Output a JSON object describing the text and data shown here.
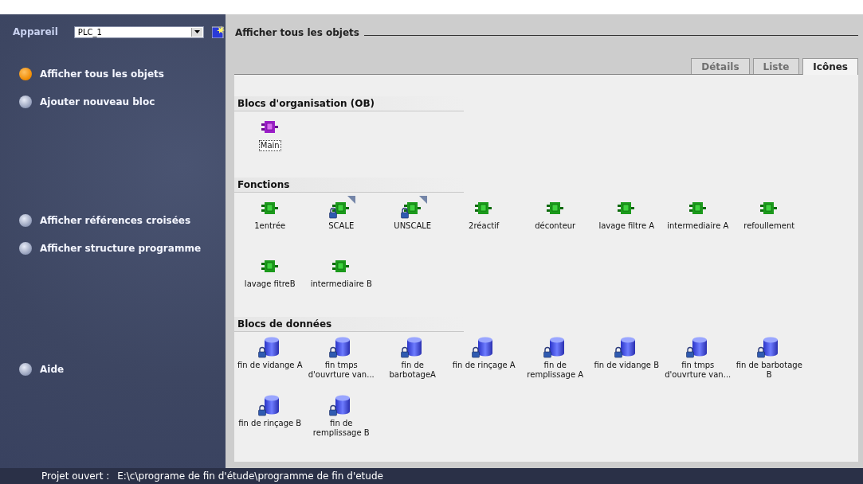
{
  "device": {
    "label": "Appareil",
    "value": "PLC_1"
  },
  "sidebar": {
    "items": [
      {
        "label": "Afficher tous les objets",
        "selected": true
      },
      {
        "label": "Ajouter nouveau bloc",
        "selected": false
      },
      {
        "label": "Afficher références croisées",
        "selected": false
      },
      {
        "label": "Afficher structure programme",
        "selected": false
      },
      {
        "label": "Aide",
        "selected": false
      }
    ]
  },
  "header": {
    "title": "Afficher tous les objets"
  },
  "tabs": [
    {
      "label": "Détails",
      "selected": false
    },
    {
      "label": "Liste",
      "selected": false
    },
    {
      "label": "Icônes",
      "selected": true
    }
  ],
  "groups": [
    {
      "title": "Blocs d'organisation (OB)",
      "blocks": [
        {
          "kind": "ob",
          "label": "Main",
          "protected": false,
          "library": false,
          "selected": true
        }
      ]
    },
    {
      "title": "Fonctions",
      "blocks": [
        {
          "kind": "fc",
          "label": "1entrée",
          "protected": false,
          "library": false,
          "selected": false
        },
        {
          "kind": "fc",
          "label": "SCALE",
          "protected": true,
          "library": true,
          "selected": false
        },
        {
          "kind": "fc",
          "label": "UNSCALE",
          "protected": true,
          "library": true,
          "selected": false
        },
        {
          "kind": "fc",
          "label": "2réactif",
          "protected": false,
          "library": false,
          "selected": false
        },
        {
          "kind": "fc",
          "label": "déconteur",
          "protected": false,
          "library": false,
          "selected": false
        },
        {
          "kind": "fc",
          "label": "lavage filtre A",
          "protected": false,
          "library": false,
          "selected": false
        },
        {
          "kind": "fc",
          "label": "intermediaire A",
          "protected": false,
          "library": false,
          "selected": false
        },
        {
          "kind": "fc",
          "label": "refoullement",
          "protected": false,
          "library": false,
          "selected": false
        },
        {
          "kind": "fc",
          "label": "lavage fitreB",
          "protected": false,
          "library": false,
          "selected": false
        },
        {
          "kind": "fc",
          "label": "intermediaire B",
          "protected": false,
          "library": false,
          "selected": false
        }
      ]
    },
    {
      "title": "Blocs de données",
      "blocks": [
        {
          "kind": "db",
          "label": "fin de vidange A",
          "protected": true,
          "library": false,
          "selected": false
        },
        {
          "kind": "db",
          "label": "fin tmps d'ouvrture van...",
          "protected": true,
          "library": false,
          "selected": false
        },
        {
          "kind": "db",
          "label": "fin de barbotageA",
          "protected": true,
          "library": false,
          "selected": false
        },
        {
          "kind": "db",
          "label": "fin de rinçage A",
          "protected": true,
          "library": false,
          "selected": false
        },
        {
          "kind": "db",
          "label": "fin de remplissage A",
          "protected": true,
          "library": false,
          "selected": false
        },
        {
          "kind": "db",
          "label": "fin de vidange B",
          "protected": true,
          "library": false,
          "selected": false
        },
        {
          "kind": "db",
          "label": "fin tmps d'ouvrture van...",
          "protected": true,
          "library": false,
          "selected": false
        },
        {
          "kind": "db",
          "label": "fin de barbotage B",
          "protected": true,
          "library": false,
          "selected": false
        },
        {
          "kind": "db",
          "label": "fin de rinçage B",
          "protected": true,
          "library": false,
          "selected": false
        },
        {
          "kind": "db",
          "label": "fin de remplissage B",
          "protected": true,
          "library": false,
          "selected": false
        }
      ]
    }
  ],
  "status_bar": {
    "label": "Projet ouvert :",
    "path": "E:\\c\\programe de fin d'étude\\programme de fin d'etude"
  }
}
